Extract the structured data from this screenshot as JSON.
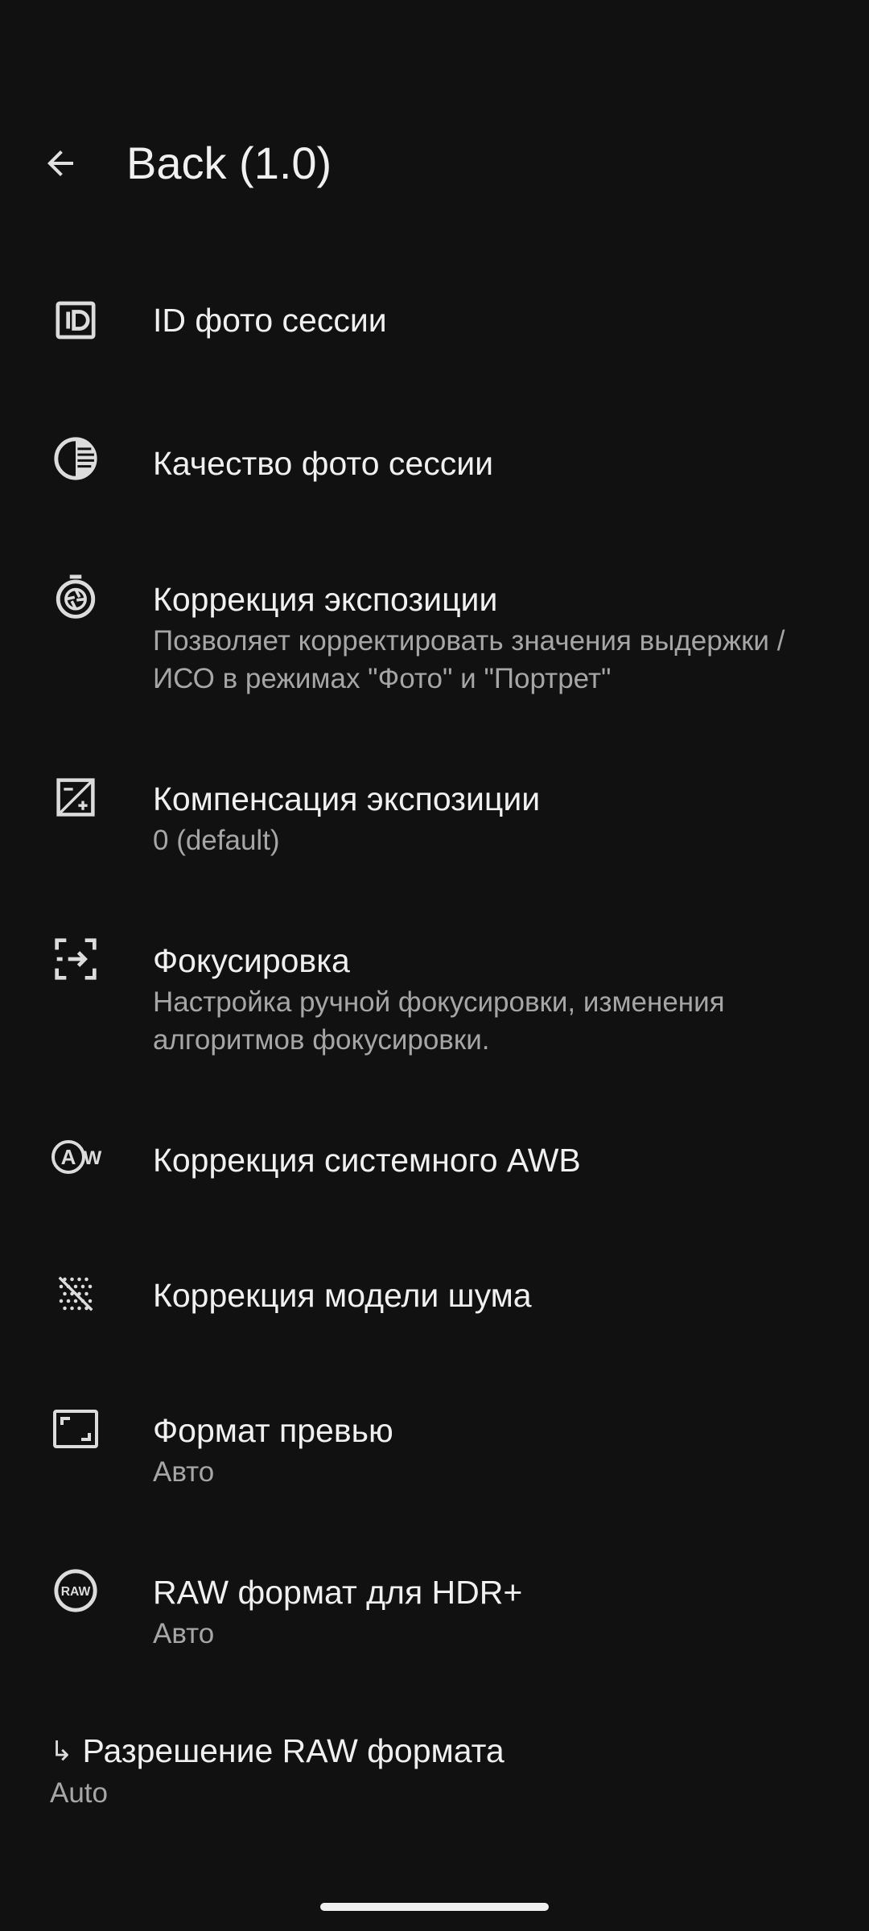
{
  "header": {
    "title": "Back  (1.0)",
    "back_icon": "arrow-back-icon"
  },
  "items": [
    {
      "label": "ID фото сессии",
      "summary": "",
      "icon": "id-card-icon"
    },
    {
      "label": "Качество фото сессии",
      "summary": "",
      "icon": "contrast-icon"
    },
    {
      "label": "Коррекция экспозиции",
      "summary": "Позволяет корректировать значения выдержки / ИСО в режимах \"Фото\" и \"Портрет\"",
      "icon": "shutter-timer-icon"
    },
    {
      "label": "Компенсация экспозиции",
      "summary": "0 (default)",
      "icon": "exposure-icon"
    },
    {
      "label": "Фокусировка",
      "summary": "Настройка ручной фокусировки, изменения алгоритмов фокусировки.",
      "icon": "focus-icon"
    },
    {
      "label": "Коррекция системного AWB",
      "summary": "",
      "icon": "awb-icon"
    },
    {
      "label": "Коррекция модели шума",
      "summary": "",
      "icon": "noise-icon"
    },
    {
      "label": "Формат превью",
      "summary": "Авто",
      "icon": "preview-frame-icon"
    },
    {
      "label": "RAW формат для HDR+",
      "summary": "Авто",
      "icon": "raw-icon"
    }
  ],
  "sub_item": {
    "label": "Разрешение RAW формата",
    "summary": "Auto",
    "icon": "subdirectory-arrow-icon"
  },
  "colors": {
    "background": "#111111",
    "text_primary": "#f0f0f0",
    "text_secondary": "#a6a6a6"
  }
}
